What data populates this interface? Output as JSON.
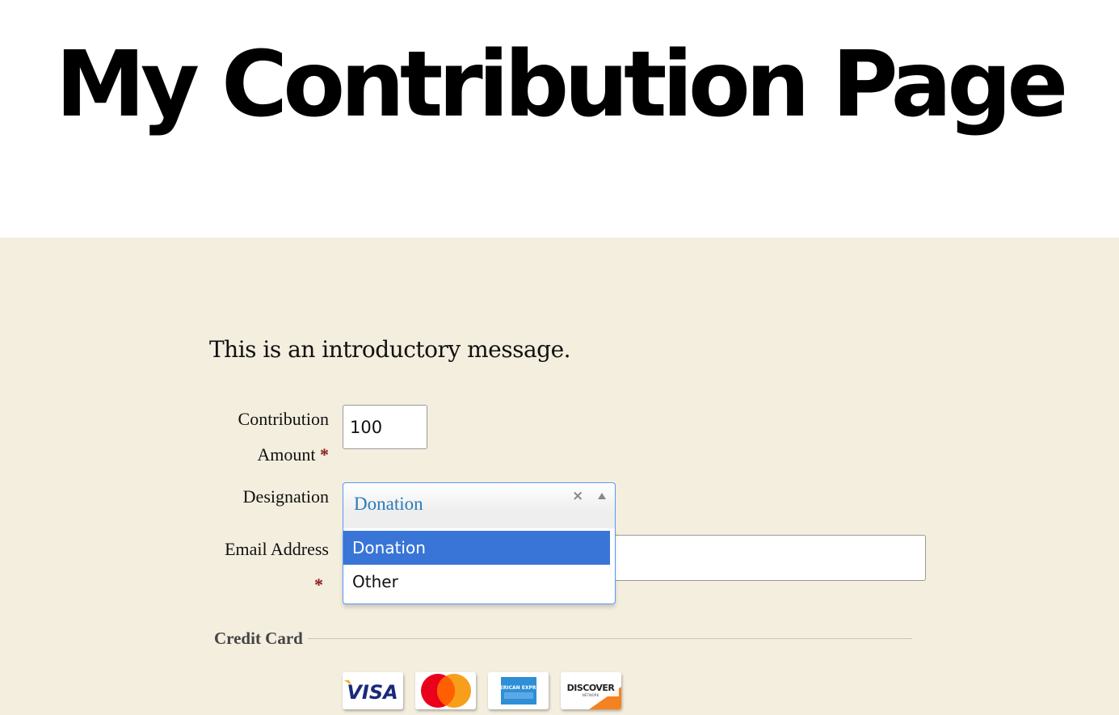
{
  "page": {
    "title": "My Contribution Page",
    "intro": "This is an introductory message."
  },
  "form": {
    "amount": {
      "label_line1": "Contribution",
      "label_line2": "Amount",
      "required_marker": "*",
      "value": "100"
    },
    "designation": {
      "label": "Designation",
      "selected": "Donation",
      "clear_glyph": "×",
      "options": [
        {
          "label": "Donation",
          "highlighted": true
        },
        {
          "label": "Other",
          "highlighted": false
        }
      ]
    },
    "email": {
      "label": "Email Address",
      "required_marker": "*",
      "value": ""
    },
    "credit_card": {
      "section_label": "Credit Card",
      "cards": [
        {
          "name": "VISA",
          "icon": "visa-card-icon"
        },
        {
          "name": "MasterCard",
          "icon": "mastercard-card-icon"
        },
        {
          "name": "AMERICAN EXPRESS",
          "icon": "amex-card-icon"
        },
        {
          "name": "DISCOVER",
          "sub": "NETWORK",
          "icon": "discover-card-icon"
        }
      ]
    }
  },
  "colors": {
    "content_bg": "#f4eedf",
    "required": "#8b1a1a",
    "select_value": "#2a7ab8",
    "option_highlight": "#3875d7",
    "focus_border": "#5897fb"
  }
}
